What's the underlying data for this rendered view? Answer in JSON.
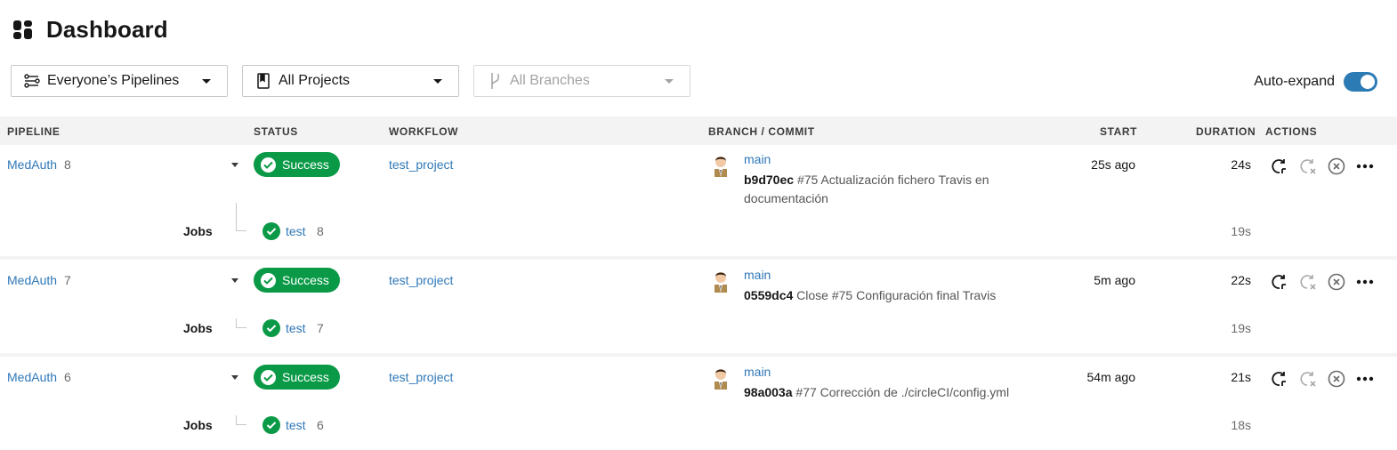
{
  "header": {
    "title": "Dashboard"
  },
  "filters": {
    "pipelines": "Everyone’s Pipelines",
    "projects": "All Projects",
    "branches": "All Branches"
  },
  "autoexpand": {
    "label": "Auto-expand",
    "enabled": true
  },
  "table": {
    "headers": {
      "pipeline": "PIPELINE",
      "status": "STATUS",
      "workflow": "WORKFLOW",
      "branch_commit": "BRANCH / COMMIT",
      "start": "START",
      "duration": "DURATION",
      "actions": "ACTIONS"
    },
    "jobs_label": "Jobs",
    "rows": [
      {
        "project": "MedAuth",
        "number": "8",
        "status": "Success",
        "workflow": "test_project",
        "branch": "main",
        "commit_hash": "b9d70ec",
        "commit_msg": "#75 Actualización fichero Travis en documentación",
        "start": "25s ago",
        "duration": "24s",
        "job": {
          "name": "test",
          "number": "8",
          "duration": "19s"
        }
      },
      {
        "project": "MedAuth",
        "number": "7",
        "status": "Success",
        "workflow": "test_project",
        "branch": "main",
        "commit_hash": "0559dc4",
        "commit_msg": "Close #75 Configuración final Travis",
        "start": "5m ago",
        "duration": "22s",
        "job": {
          "name": "test",
          "number": "7",
          "duration": "19s"
        }
      },
      {
        "project": "MedAuth",
        "number": "6",
        "status": "Success",
        "workflow": "test_project",
        "branch": "main",
        "commit_hash": "98a003a",
        "commit_msg": "#77 Corrección de ./circleCI/config.yml",
        "start": "54m ago",
        "duration": "21s",
        "job": {
          "name": "test",
          "number": "6",
          "duration": "18s"
        }
      }
    ]
  },
  "colors": {
    "success": "#0a9a47",
    "link": "#2f78b8",
    "toggle": "#2d7bb5"
  },
  "icons": {
    "title": "dashboard-grid-icon",
    "actions": [
      "rerun-icon",
      "rerun-failed-icon",
      "cancel-icon",
      "more-icon"
    ]
  }
}
